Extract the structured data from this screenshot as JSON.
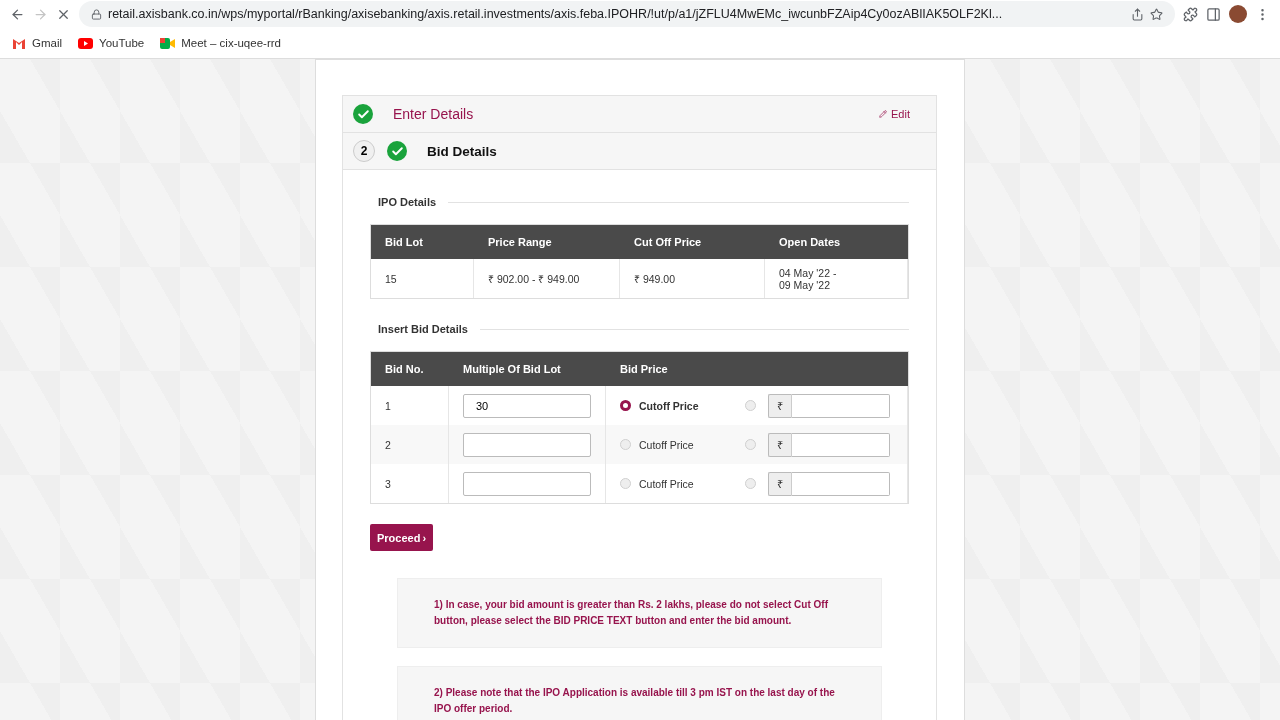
{
  "browser": {
    "url": "retail.axisbank.co.in/wps/myportal/rBanking/axisebanking/axis.retail.investments/axis.feba.IPOHR/!ut/p/a1/jZFLU4MwEMc_iwcunbFZAip4Cy0ozABlIAK5OLF2Kl...",
    "loading": true,
    "bookmarks": [
      {
        "label": "Gmail",
        "kind": "gmail"
      },
      {
        "label": "YouTube",
        "kind": "youtube"
      },
      {
        "label": "Meet – cix-uqee-rrd",
        "kind": "meet"
      }
    ]
  },
  "steps": [
    {
      "title": "Enter Details",
      "done": true,
      "active": false,
      "action": "Edit"
    },
    {
      "number": "2",
      "title": "Bid Details",
      "done": true,
      "active": true
    }
  ],
  "ipo_details": {
    "heading": "IPO Details",
    "columns": [
      "Bid Lot",
      "Price Range",
      "Cut Off Price",
      "Open Dates"
    ],
    "rows": [
      [
        "15",
        "₹ 902.00 - ₹ 949.00",
        "₹ 949.00",
        "04 May '22 -\n09 May '22"
      ]
    ]
  },
  "bid_details": {
    "heading": "Insert Bid Details",
    "columns": [
      "Bid No.",
      "Multiple Of Bid Lot",
      "Bid Price"
    ],
    "rows": [
      {
        "number": "1",
        "multiple": "30",
        "cutoff_label": "Cutoff Price",
        "cutoff_selected": true,
        "price_selected": false,
        "currency": "₹"
      },
      {
        "number": "2",
        "cutoff_label": "Cutoff Price",
        "cutoff_selected": false,
        "price_selected": false,
        "currency": "₹"
      },
      {
        "number": "3",
        "cutoff_label": "Cutoff Price",
        "cutoff_selected": false,
        "price_selected": false,
        "currency": "₹"
      }
    ]
  },
  "proceed_button": "Proceed",
  "proceed_arrow": "›",
  "notes": [
    "1) In case, your bid amount is greater than Rs. 2 lakhs, please do not select Cut Off button, please select the BID PRICE TEXT button and enter the bid amount.",
    "2) Please note that the IPO Application is available till 3 pm IST on the last day of the IPO offer period."
  ]
}
